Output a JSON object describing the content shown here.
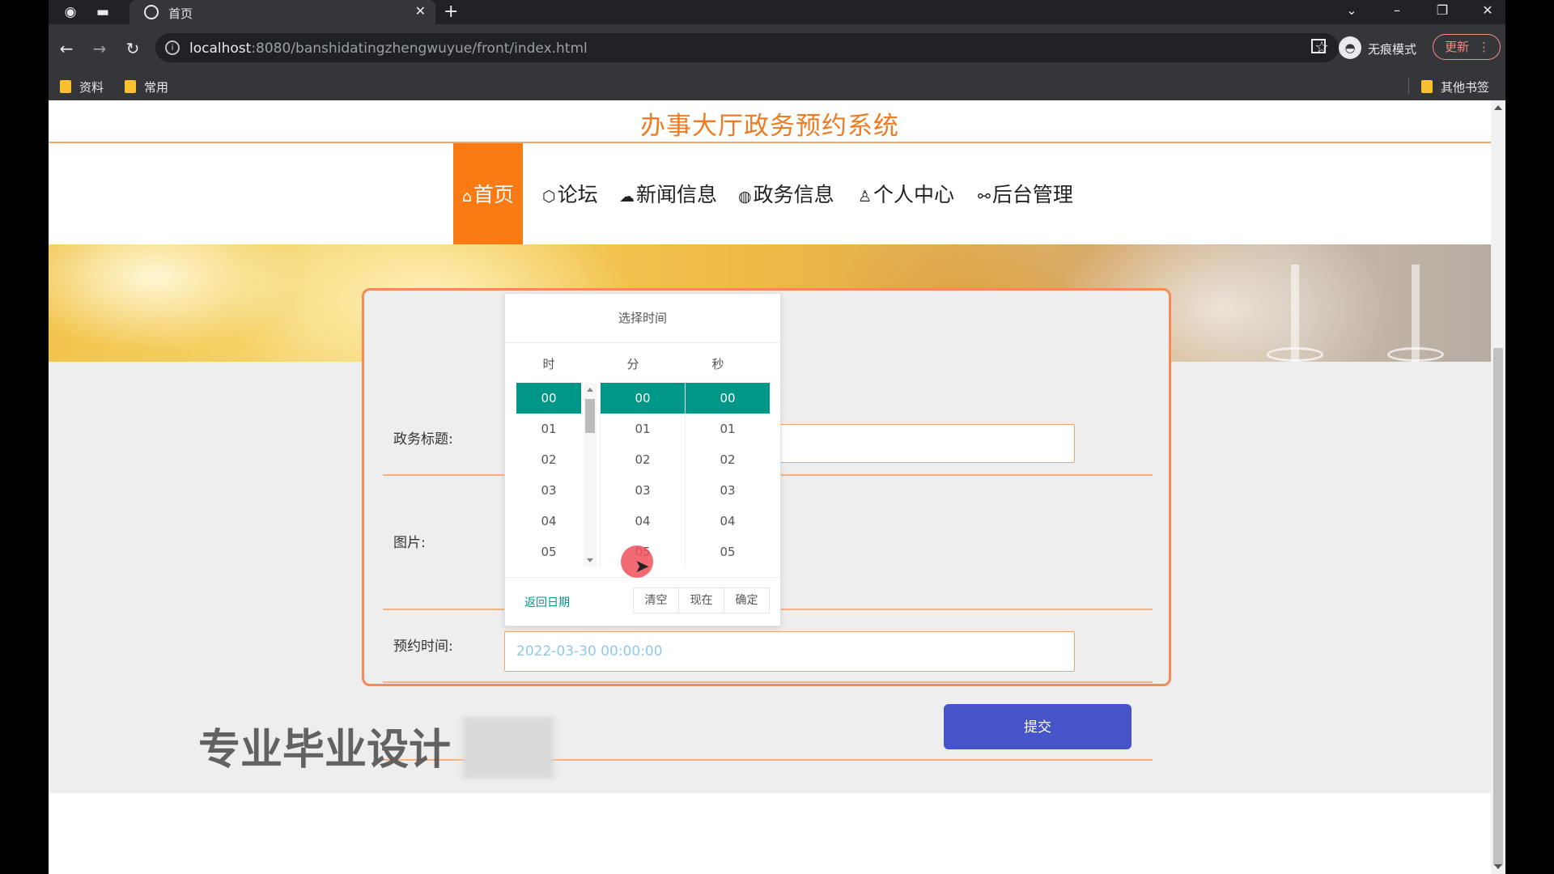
{
  "browser": {
    "tab_title": "首页",
    "url_host": "localhost",
    "url_path": ":8080/banshidatingzhengwuyue/front/index.html",
    "incognito_label": "无痕模式",
    "update_label": "更新",
    "bookmarks": [
      "资料",
      "常用"
    ],
    "other_bookmarks": "其他书签"
  },
  "site": {
    "title": "办事大厅政务预约系统",
    "nav": [
      {
        "label": "首页",
        "icon": "home-icon"
      },
      {
        "label": "论坛",
        "icon": "cube-icon"
      },
      {
        "label": "新闻信息",
        "icon": "cloud-icon"
      },
      {
        "label": "政务信息",
        "icon": "globe-icon"
      },
      {
        "label": "个人中心",
        "icon": "user-icon"
      },
      {
        "label": "后台管理",
        "icon": "link-icon"
      }
    ]
  },
  "form": {
    "title_label": "政务标题:",
    "image_label": "图片:",
    "time_label": "预约时间:",
    "time_value": "2022-03-30 00:00:00",
    "submit_label": "提交"
  },
  "picker": {
    "title": "选择时间",
    "headers": [
      "时",
      "分",
      "秒"
    ],
    "hours": [
      "00",
      "01",
      "02",
      "03",
      "04",
      "05"
    ],
    "minutes": [
      "00",
      "01",
      "02",
      "03",
      "04",
      "05"
    ],
    "seconds": [
      "00",
      "01",
      "02",
      "03",
      "04",
      "05"
    ],
    "back_date": "返回日期",
    "clear": "清空",
    "now": "现在",
    "confirm": "确定"
  },
  "watermark": "专业毕业设计",
  "colors": {
    "accent": "#fa7a14",
    "title": "#f07b22",
    "picker_selected": "#009688",
    "submit": "#4754c9",
    "border": "#f48a57"
  }
}
